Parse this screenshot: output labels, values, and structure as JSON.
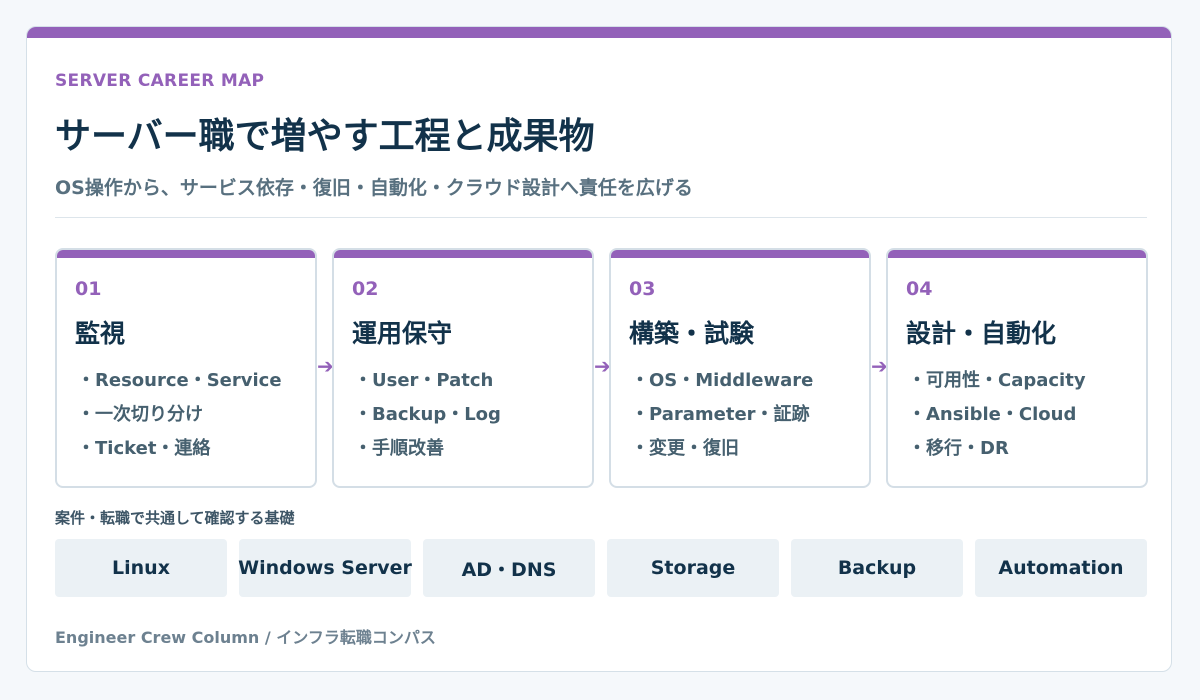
{
  "header": {
    "eyebrow": "SERVER CAREER MAP",
    "title": "サーバー職で増やす工程と成果物",
    "subtitle": "OS操作から、サービス依存・復旧・自動化・クラウド設計へ責任を広げる"
  },
  "steps": [
    {
      "num": "01",
      "title": "監視",
      "items": [
        "・Resource・Service",
        "・一次切り分け",
        "・Ticket・連絡"
      ]
    },
    {
      "num": "02",
      "title": "運用保守",
      "items": [
        "・User・Patch",
        "・Backup・Log",
        "・手順改善"
      ]
    },
    {
      "num": "03",
      "title": "構築・試験",
      "items": [
        "・OS・Middleware",
        "・Parameter・証跡",
        "・変更・復旧"
      ]
    },
    {
      "num": "04",
      "title": "設計・自動化",
      "items": [
        "・可用性・Capacity",
        "・Ansible・Cloud",
        "・移行・DR"
      ]
    }
  ],
  "arrow_glyph": "➔",
  "base": {
    "label": "案件・転職で共通して確認する基礎",
    "chips": [
      "Linux",
      "Windows Server",
      "AD・DNS",
      "Storage",
      "Backup",
      "Automation"
    ]
  },
  "footer": "Engineer Crew Column / インフラ転職コンパス",
  "colors": {
    "accent": "#9361b9",
    "heading": "#12324a",
    "body_text": "#46606f",
    "chip_bg": "#ebf1f5",
    "border": "#d4dee6",
    "page_bg": "#f5f8fb"
  }
}
